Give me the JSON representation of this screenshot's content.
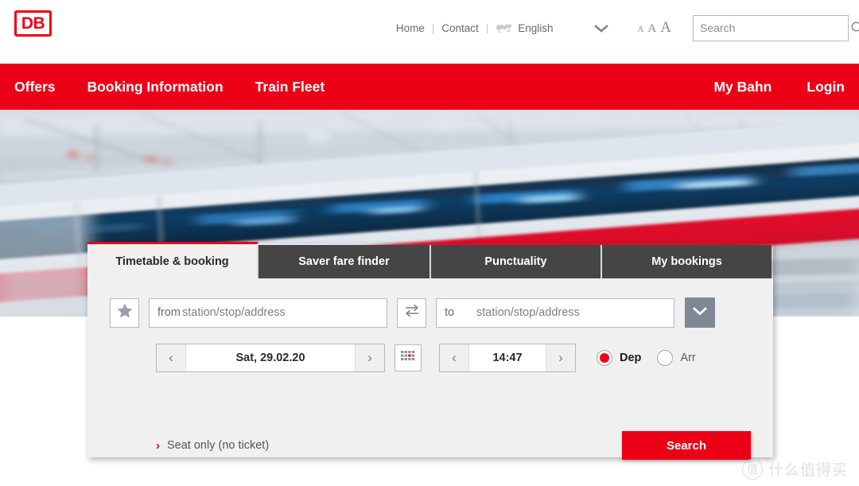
{
  "header": {
    "logo_text": "DB",
    "logo_name": "deutsche-bahn-logo",
    "links": [
      {
        "label": "Home"
      },
      {
        "label": "Contact"
      }
    ],
    "separator": "|",
    "language": {
      "label": "English",
      "globe_icon": "globe-icon",
      "chevron_icon": "chevron-down-icon"
    },
    "font_size": {
      "small": "A",
      "medium": "A",
      "large": "A"
    },
    "search": {
      "placeholder": "Search",
      "value": "",
      "icon": "search-icon"
    }
  },
  "mainnav": {
    "background_color": "#ec0016",
    "left_items": [
      {
        "label": "Offers"
      },
      {
        "label": "Booking Information"
      },
      {
        "label": "Train Fleet"
      }
    ],
    "right_items": [
      {
        "label": "My Bahn"
      },
      {
        "label": "Login"
      }
    ]
  },
  "hero": {
    "alt": "motion-blurred ICE high-speed train passing through a station platform"
  },
  "widget": {
    "tabs": [
      {
        "label": "Timetable & booking",
        "active": true
      },
      {
        "label": "Saver fare finder",
        "active": false
      },
      {
        "label": "Punctuality",
        "active": false
      },
      {
        "label": "My bookings",
        "active": false
      }
    ],
    "active_tab_accent": "#ec0016",
    "favorites_button": {
      "icon": "star-icon"
    },
    "from": {
      "prefix": "from",
      "placeholder": "station/stop/address",
      "value": ""
    },
    "swap_button": {
      "icon": "swap-arrows-icon"
    },
    "to": {
      "prefix": "to",
      "placeholder": "station/stop/address",
      "value": ""
    },
    "expand_button": {
      "icon": "chevron-down-icon"
    },
    "date": {
      "value": "Sat, 29.02.20",
      "prev_icon": "chevron-left-icon",
      "next_icon": "chevron-right-icon"
    },
    "calendar_button": {
      "icon": "calendar-icon"
    },
    "time": {
      "value": "14:47",
      "prev_icon": "chevron-left-icon",
      "next_icon": "chevron-right-icon"
    },
    "dep_arr": [
      {
        "label": "Dep",
        "selected": true
      },
      {
        "label": "Arr",
        "selected": false
      }
    ],
    "seat_only_link": {
      "label": "Seat only (no ticket)",
      "chevron": "›"
    },
    "search_button": {
      "label": "Search",
      "color": "#ec0016"
    }
  },
  "watermark": {
    "logo_char": "值",
    "text": "什么值得买"
  }
}
